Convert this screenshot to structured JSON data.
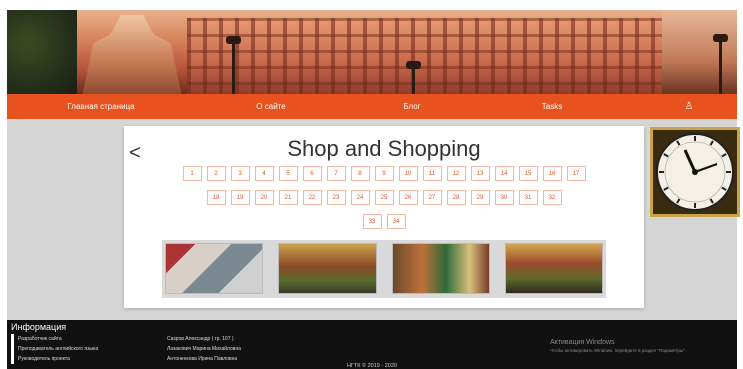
{
  "nav": {
    "home": "Главная страница",
    "about": "О сайте",
    "blog": "Блог",
    "tasks": "Tasks",
    "user_icon": "person-icon",
    "user_glyph": "♙"
  },
  "card": {
    "back_glyph": "<",
    "title": "Shop and Shopping",
    "pages_row1": [
      "1",
      "2",
      "3",
      "4",
      "5",
      "6",
      "7",
      "8",
      "9",
      "10",
      "11",
      "12",
      "13",
      "14",
      "15",
      "16",
      "17"
    ],
    "pages_row2": [
      "18",
      "19",
      "20",
      "21",
      "22",
      "23",
      "24",
      "25",
      "26",
      "27",
      "28",
      "29",
      "30",
      "31",
      "32"
    ],
    "pages_row3": [
      "33",
      "34"
    ]
  },
  "footer": {
    "heading": "Информация",
    "roles": [
      "Разработчик сайта",
      "Преподаватель английского языка",
      "Руководитель проекта"
    ],
    "names": [
      "Сазров Александр ( гр. 107 )",
      "Лазакович Марина Михайловна",
      "Антоненкова Ирина Павловна"
    ],
    "copyright": "НГТК © 2019 - 2020",
    "windows_title": "Активация Windows",
    "windows_text": "Чтобы активировать Windows, перейдите в раздел \"Параметры\"."
  },
  "colors": {
    "accent": "#e8521f",
    "footer_bg": "#111111",
    "main_bg": "#d6d6d6"
  }
}
